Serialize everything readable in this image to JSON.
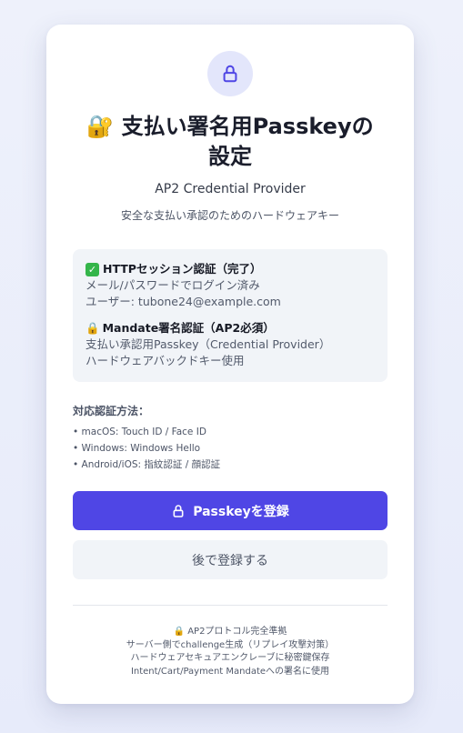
{
  "header": {
    "title_emoji": "🔐",
    "title_line1": "支払い署名用Passkeyの",
    "title_line2": "設定",
    "subtitle": "AP2 Credential Provider",
    "description": "安全な支払い承認のためのハードウェアキー"
  },
  "info_box": {
    "http_section": {
      "icon": "check-mark-icon",
      "title": "HTTPセッション認証（完了）",
      "line1": "メール/パスワードでログイン済み",
      "line2": "ユーザー: tubone24@example.com"
    },
    "mandate_section": {
      "icon": "lock-icon",
      "title": "Mandate署名認証（AP2必須）",
      "line1": "支払い承認用Passkey（Credential Provider）",
      "line2": "ハードウェアバックドキー使用"
    }
  },
  "methods": {
    "title": "対応認証方法：",
    "items": [
      "• macOS: Touch ID / Face ID",
      "• Windows: Windows Hello",
      "• Android/iOS: 指紋認証 / 顔認証"
    ]
  },
  "buttons": {
    "register_label": "Passkeyを登録",
    "later_label": "後で登録する"
  },
  "footer": {
    "line1_icon": "🔒",
    "line1": "AP2プロトコル完全準拠",
    "line2": "サーバー側でchallenge生成（リプレイ攻撃対策）",
    "line3": "ハードウェアセキュアエンクレーブに秘密鍵保存",
    "line4": "Intent/Cart/Payment Mandateへの署名に使用"
  },
  "colors": {
    "accent": "#4f46e5",
    "icon_circle": "#e3e6fb",
    "info_bg": "#f1f4f8",
    "check": "#34b54a"
  }
}
